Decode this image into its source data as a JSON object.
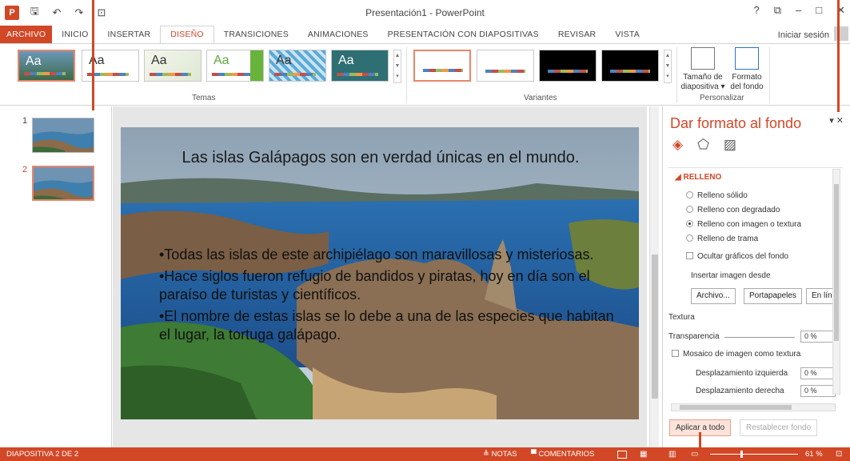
{
  "window": {
    "title": "Presentación1 - PowerPoint",
    "help": "?",
    "controls": [
      "⧉",
      "–",
      "□",
      "✕"
    ]
  },
  "qat": {
    "app_logo": "P",
    "save": "🖫",
    "undo": "↶",
    "redo": "↷",
    "presenter": "⊡"
  },
  "tabs": [
    "ARCHIVO",
    "INICIO",
    "INSERTAR",
    "DISEÑO",
    "TRANSICIONES",
    "ANIMACIONES",
    "PRESENTACIÓN CON DIAPOSITIVAS",
    "REVISAR",
    "VISTA"
  ],
  "active_tab": "DISEÑO",
  "signin": "Iniciar sesión",
  "ribbon": {
    "themes_label": "Temas",
    "variants_label": "Variantes",
    "customize_label": "Personalizar",
    "theme_text": "Aa",
    "slide_size": {
      "line1": "Tamaño de",
      "line2": "diapositiva ▾"
    },
    "format_bg": {
      "line1": "Formato",
      "line2": "del fondo"
    }
  },
  "slides_pane": {
    "numbers": [
      "1",
      "2"
    ]
  },
  "slide": {
    "title": "Las islas Galápagos son en verdad únicas en el mundo.",
    "bullets": [
      "•Todas las islas de este archipiélago son maravillosas y misteriosas.",
      "•Hace siglos fueron refugio de bandidos y piratas, hoy en día son el paraíso de turistas y científicos.",
      "•El nombre de estas islas se lo debe a una de las especies que habitan el lugar, la tortuga galápago."
    ]
  },
  "format_pane": {
    "title": "Dar formato al fondo",
    "controls": "▾ ✕",
    "section": "◢ RELLENO",
    "fill_options": [
      "Relleno sólido",
      "Relleno con degradado",
      "Relleno con imagen o textura",
      "Relleno de trama"
    ],
    "selected_fill": "Relleno con imagen o textura",
    "hide_bg": "Ocultar gráficos del fondo",
    "insert_from": "Insertar imagen desde",
    "btn_file": "Archivo...",
    "btn_clipboard": "Portapapeles",
    "btn_online": "En lín",
    "texture": "Textura",
    "transparency": "Transparencia",
    "transparency_value": "0 %",
    "tile": "Mosaico de imagen como textura",
    "offset_left": "Desplazamiento izquierda",
    "offset_left_value": "0 %",
    "offset_right": "Desplazamiento derecha",
    "offset_right_value": "0 %",
    "apply_all": "Aplicar a todo",
    "reset": "Restablecer fondo"
  },
  "statusbar": {
    "slide_info": "DIAPOSITIVA 2 DE 2",
    "notes": "≜ NOTAS",
    "comments": "▀ COMENTARIOS",
    "zoom": "61 %"
  },
  "colors": {
    "accent": "#d24726"
  }
}
